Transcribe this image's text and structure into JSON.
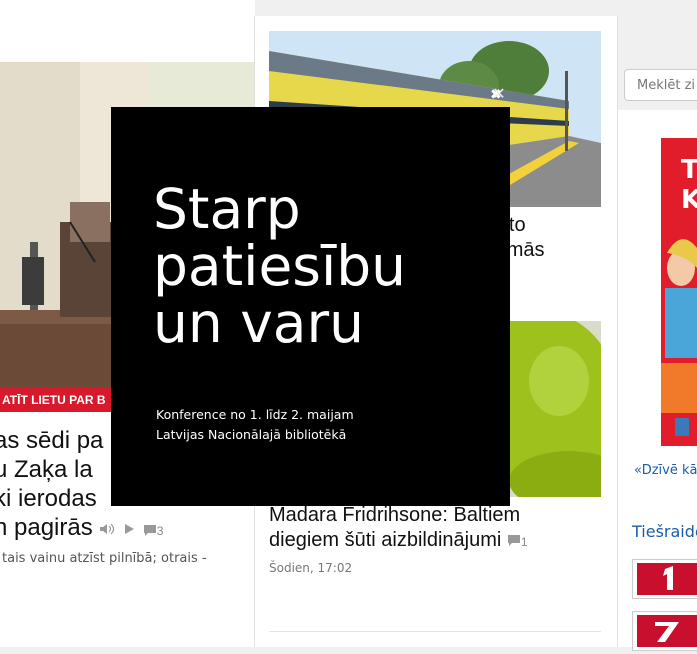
{
  "left_article": {
    "banner_text": "ATĪT LIETU PAR B",
    "headline_lines": [
      "as sēdi pa",
      "u Zaķa la",
      "ki ierodas",
      "n pagirās"
    ],
    "comment_count": "3",
    "snippet": "tais vainu atzīst pilnībā; otrais -"
  },
  "train_article": {
    "headline_lines": [
      "raukto",
      "izdomās"
    ]
  },
  "center_article": {
    "headline_lines": [
      "Madara Fridrihsone: Baltiem",
      "diegiem šūti aizbildinājumi"
    ],
    "comment_count": "1",
    "time": "Šodien, 17:02"
  },
  "right_column": {
    "search_placeholder": "Meklēt zi",
    "ad_link": "«Dzīvē kā",
    "live_label": "Tiešraide"
  },
  "overlay": {
    "title_lines": [
      "Starp",
      "patiesību",
      "un varu"
    ],
    "subtitle_line1": "Konference no 1. līdz 2. maijam",
    "subtitle_line2": "Latvijas Nacionālajā bibliotēkā",
    "close_glyph": "✕"
  },
  "colors": {
    "link_blue": "#1a5ea8",
    "overlay_bg": "#000000",
    "banner_red": "#d8182b",
    "channel_red": "#c8102e"
  }
}
